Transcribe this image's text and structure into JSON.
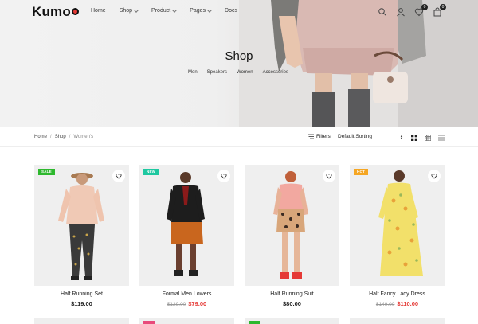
{
  "brand": {
    "name": "Kumo",
    "accent": "#e53935"
  },
  "nav": [
    {
      "label": "Home",
      "has_dropdown": false
    },
    {
      "label": "Shop",
      "has_dropdown": true
    },
    {
      "label": "Product",
      "has_dropdown": true
    },
    {
      "label": "Pages",
      "has_dropdown": true
    },
    {
      "label": "Docs",
      "has_dropdown": false
    }
  ],
  "header_icons": {
    "wishlist_count": "0",
    "cart_count": "0"
  },
  "hero": {
    "title": "Shop",
    "categories": [
      "Men",
      "Speakers",
      "Women",
      "Accessories"
    ]
  },
  "toolbar": {
    "breadcrumb": [
      "Home",
      "Shop",
      "Women's"
    ],
    "breadcrumb_sep": "/",
    "filters_label": "Filters",
    "sort_value": "Default Sorting"
  },
  "products": [
    {
      "name": "Half Running Set",
      "price": "$119.00",
      "old_price": "",
      "tag": "SALE",
      "tag_color": "#2eb82e"
    },
    {
      "name": "Formal Men Lowers",
      "price": "$79.00",
      "old_price": "$129.00",
      "tag": "NEW",
      "tag_color": "#1ec8a0"
    },
    {
      "name": "Half Running Suit",
      "price": "$80.00",
      "old_price": "",
      "tag": "",
      "tag_color": ""
    },
    {
      "name": "Half Fancy Lady Dress",
      "price": "$110.00",
      "old_price": "$149.00",
      "tag": "HOT",
      "tag_color": "#f5a623"
    }
  ],
  "next_row_tags": [
    {
      "tag": "",
      "tag_color": ""
    },
    {
      "tag": "",
      "tag_color": "#e84a7a"
    },
    {
      "tag": "",
      "tag_color": "#2eb82e"
    },
    {
      "tag": "",
      "tag_color": ""
    }
  ]
}
